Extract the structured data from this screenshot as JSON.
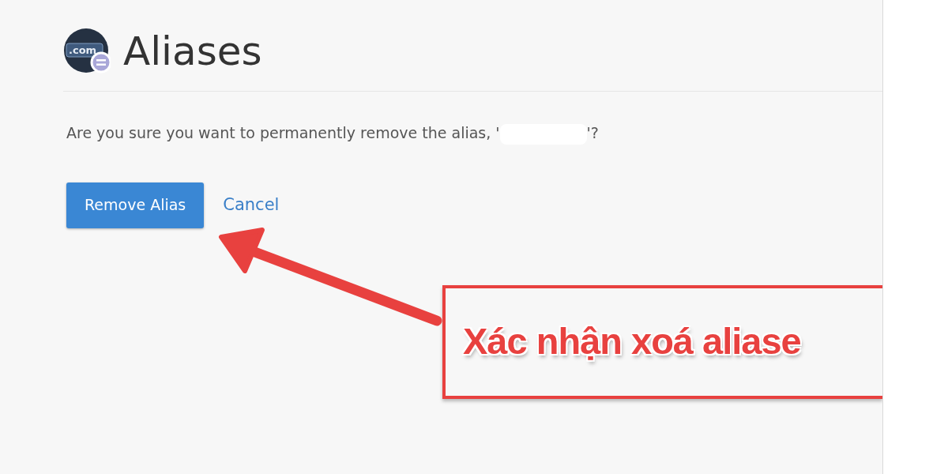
{
  "header": {
    "icon_label": ".com",
    "title": "Aliases"
  },
  "message": {
    "text": "Are you sure you want to permanently remove the alias, '",
    "redacted": true,
    "end": "'?"
  },
  "actions": [
    {
      "kind": "primary",
      "label": "Remove Alias"
    },
    {
      "kind": "link",
      "label": "Cancel"
    }
  ],
  "annotation": {
    "text": "Xác nhận xoá aliase"
  }
}
